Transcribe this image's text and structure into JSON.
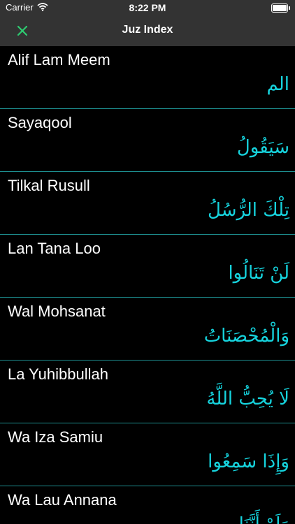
{
  "statusbar": {
    "carrier": "Carrier",
    "time": "8:22 PM",
    "wifi_icon": "wifi-icon",
    "battery_icon": "battery-icon"
  },
  "navbar": {
    "title": "Juz Index",
    "close_icon": "close-icon",
    "accent": "#2ecc71"
  },
  "colors": {
    "arabic": "#16d3dd",
    "separator": "#1d8e8f",
    "bar": "#333333"
  },
  "juz": [
    {
      "name": "Alif Lam Meem",
      "arabic": "الم"
    },
    {
      "name": "Sayaqool",
      "arabic": "سَيَقُولُ"
    },
    {
      "name": "Tilkal Rusull",
      "arabic": "تِلْكَ الرُّسُلُ"
    },
    {
      "name": "Lan Tana Loo",
      "arabic": "لَنْ تَنَالُوا"
    },
    {
      "name": "Wal Mohsanat",
      "arabic": "وَالْمُحْصَنَاتُ"
    },
    {
      "name": "La Yuhibbullah",
      "arabic": "لَا يُحِبُّ اللَّهُ"
    },
    {
      "name": "Wa Iza Samiu",
      "arabic": "وَإِذَا سَمِعُوا"
    },
    {
      "name": "Wa Lau Annana",
      "arabic": "وَلَوْ أَنَّنَا"
    }
  ]
}
